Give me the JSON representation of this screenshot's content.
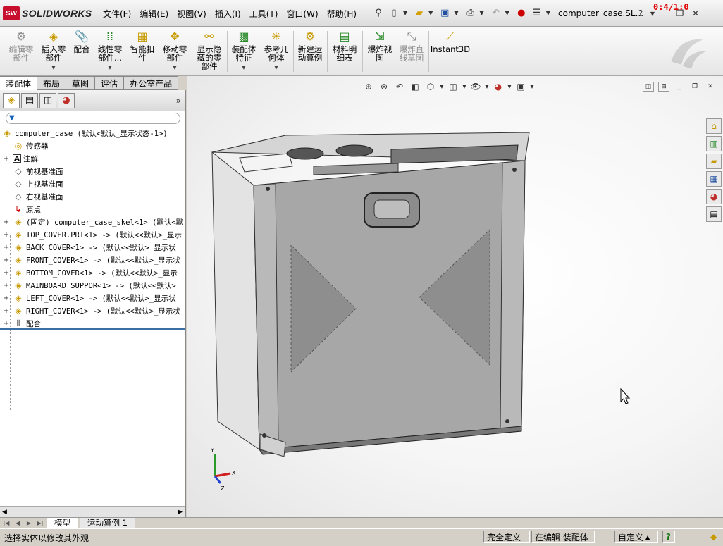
{
  "app": {
    "logo_mark": "SW",
    "name": "SOLIDWORKS",
    "file_title": "computer_case.SL...",
    "timer": "0:4/1:0"
  },
  "menus": [
    "文件(F)",
    "编辑(E)",
    "视图(V)",
    "插入(I)",
    "工具(T)",
    "窗口(W)",
    "帮助(H)"
  ],
  "commands": [
    {
      "label1": "编辑零",
      "label2": "部件",
      "icon": "edit-component-icon",
      "enabled": false
    },
    {
      "label1": "插入零",
      "label2": "部件",
      "icon": "insert-component-icon",
      "enabled": true
    },
    {
      "label1": "配合",
      "label2": "",
      "icon": "mate-icon",
      "enabled": true
    },
    {
      "label1": "线性零",
      "label2": "部件...",
      "icon": "linear-pattern-icon",
      "enabled": true
    },
    {
      "label1": "智能扣",
      "label2": "件",
      "icon": "smart-fasteners-icon",
      "enabled": true
    },
    {
      "label1": "移动零",
      "label2": "部件",
      "icon": "move-component-icon",
      "enabled": true
    },
    {
      "label1": "显示隐",
      "label2": "藏的零",
      "label3": "部件",
      "icon": "show-hidden-icon",
      "enabled": true
    },
    {
      "label1": "装配体",
      "label2": "特征",
      "icon": "assembly-feature-icon",
      "enabled": true
    },
    {
      "label1": "参考几",
      "label2": "何体",
      "icon": "reference-geometry-icon",
      "enabled": true
    },
    {
      "label1": "新建运",
      "label2": "动算例",
      "icon": "new-motion-study-icon",
      "enabled": true
    },
    {
      "label1": "材料明",
      "label2": "细表",
      "icon": "bill-of-materials-icon",
      "enabled": true
    },
    {
      "label1": "爆炸视",
      "label2": "图",
      "icon": "exploded-view-icon",
      "enabled": true
    },
    {
      "label1": "爆炸直",
      "label2": "线草图",
      "icon": "explode-line-sketch-icon",
      "enabled": false
    },
    {
      "label1": "Instant3D",
      "label2": "",
      "icon": "instant3d-icon",
      "enabled": true
    }
  ],
  "tabs": [
    "装配体",
    "布局",
    "草图",
    "评估",
    "办公室产品"
  ],
  "tree": {
    "root": "computer_case  (默认<默认_显示状态-1>)",
    "items": [
      {
        "expand": "",
        "label": "传感器",
        "icon": "sensor-icon"
      },
      {
        "expand": "+",
        "label": "注解",
        "icon": "annotation-icon"
      },
      {
        "expand": "",
        "label": "前视基准面",
        "icon": "plane-icon"
      },
      {
        "expand": "",
        "label": "上视基准面",
        "icon": "plane-icon"
      },
      {
        "expand": "",
        "label": "右视基准面",
        "icon": "plane-icon"
      },
      {
        "expand": "",
        "label": "原点",
        "icon": "origin-icon"
      },
      {
        "expand": "+",
        "label": "(固定) computer_case_skel<1> (默认<默",
        "icon": "part-icon"
      },
      {
        "expand": "+",
        "label": "TOP_COVER.PRT<1> -> (默认<<默认>_显示",
        "icon": "part-icon"
      },
      {
        "expand": "+",
        "label": "BACK_COVER<1> -> (默认<<默认>_显示状",
        "icon": "part-icon"
      },
      {
        "expand": "+",
        "label": "FRONT_COVER<1> -> (默认<<默认>_显示状",
        "icon": "part-icon"
      },
      {
        "expand": "+",
        "label": "BOTTOM_COVER<1> -> (默认<<默认>_显示",
        "icon": "part-icon"
      },
      {
        "expand": "+",
        "label": "MAINBOARD_SUPPOR<1> -> (默认<<默认>_",
        "icon": "part-icon"
      },
      {
        "expand": "+",
        "label": "LEFT_COVER<1> -> (默认<<默认>_显示状",
        "icon": "part-icon"
      },
      {
        "expand": "+",
        "label": "RIGHT_COVER<1> -> (默认<<默认>_显示状",
        "icon": "part-icon"
      },
      {
        "expand": "+",
        "label": "配合",
        "icon": "mates-folder-icon"
      }
    ]
  },
  "triad": {
    "x": "X",
    "y": "Y",
    "z": "Z"
  },
  "bottom_tabs": [
    "模型",
    "运动算例 1"
  ],
  "status": {
    "message": "选择实体以修改其外观",
    "defined": "完全定义",
    "editing": "在编辑 装配体",
    "units": "自定义",
    "help": "?"
  },
  "colors": {
    "accent": "#3a6ea5",
    "timer": "#e00000",
    "brand": "#c8102e"
  }
}
